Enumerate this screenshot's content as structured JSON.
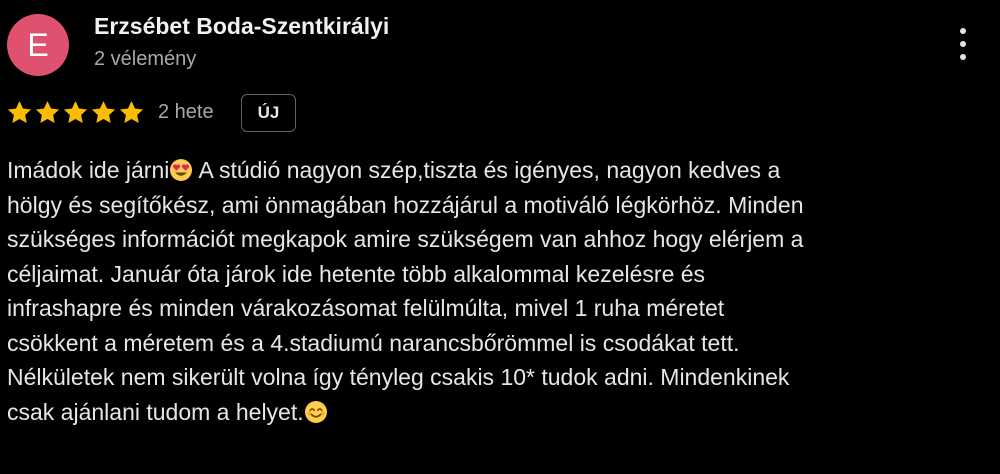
{
  "reviewer": {
    "avatar_letter": "E",
    "avatar_color": "#e0516f",
    "name": "Erzsébet Boda-Szentkirályi",
    "review_count": "2 vélemény"
  },
  "menu": {
    "icon": "more-vert-icon"
  },
  "rating": {
    "stars": 5,
    "max_stars": 5,
    "star_color": "#fbbc04",
    "time": "2 hete",
    "badge": "ÚJ"
  },
  "review": {
    "lines": [
      {
        "text": "Imádok ide járni",
        "emoji": "heart-eyes-emoji",
        "after": " A stúdió nagyon szép,tiszta és igényes, nagyon kedves a"
      },
      {
        "text": "hölgy és segítőkész, ami önmagában hozzájárul a motiváló légkörhöz. Minden"
      },
      {
        "text": "szükséges információt megkapok amire szükségem van ahhoz hogy elérjem a"
      },
      {
        "text": "céljaimat. Január óta járok ide hetente több alkalommal kezelésre és"
      },
      {
        "text": "infrashapre és minden várakozásomat felülmúlta, mivel 1 ruha méretet"
      },
      {
        "text": "csökkent a méretem és a 4.stadiumú narancsbőrömmel is csodákat tett."
      },
      {
        "text": "Nélkületek nem sikerült volna így tényleg csakis 10* tudok adni. Minden kinek",
        "display": "Nélkületek nem sikerült volna így tényleg csakis 10* tudok adni. Mindenkinek"
      },
      {
        "text": "csak ajánlani tudom a helyet.",
        "emoji": "smiling-emoji",
        "after": ""
      }
    ]
  }
}
